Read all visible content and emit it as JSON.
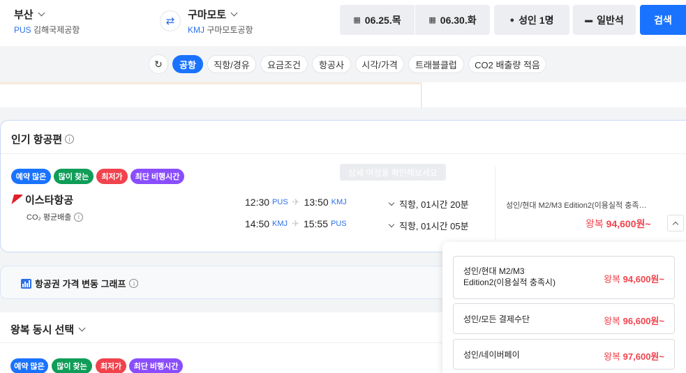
{
  "header": {
    "origin": {
      "city": "부산",
      "code": "PUS",
      "airport": "김해국제공항"
    },
    "destination": {
      "city": "구마모토",
      "code": "KMJ",
      "airport": "구마모토공항"
    },
    "depart_date": "06.25.목",
    "return_date": "06.30.화",
    "passengers": "성인 1명",
    "cabin": "일반석",
    "search": "검색"
  },
  "filters": [
    "공항",
    "직항/경유",
    "요금조건",
    "항공사",
    "시각/가격",
    "트래블클럽",
    "CO2 배출량 적음"
  ],
  "popular": {
    "title": "인기 항공편",
    "badges": [
      "예약 많은",
      "많이 찾는",
      "최저가",
      "최단 비행시간"
    ],
    "tooltip": "상세 여정을 확인해보세요",
    "airline": "이스타항공",
    "co2": "CO₂ 평균배출",
    "legs": [
      {
        "dep_time": "12:30",
        "dep_code": "PUS",
        "arr_time": "13:50",
        "arr_code": "KMJ",
        "type": "직항, 01시간 20분"
      },
      {
        "dep_time": "14:50",
        "dep_code": "KMJ",
        "arr_time": "15:55",
        "arr_code": "PUS",
        "type": "직항, 01시간 05분"
      }
    ],
    "fare_label": "성인/현대 M2/M3 Edition2(이용실적 충족…",
    "fare_prefix": "왕복",
    "fare_price": "94,600원~"
  },
  "graph": {
    "title": "항공권 가격 변동 그래프"
  },
  "roundtrip": {
    "title": "왕복 동시 선택",
    "badges": [
      "예약 많은",
      "많이 찾는",
      "최저가",
      "최단 비행시간"
    ]
  },
  "fare_options": [
    {
      "label_line1": "성인/현대 M2/M3",
      "label_line2": "Edition2(이용실적 충족시)",
      "prefix": "왕복",
      "price": "94,600원~"
    },
    {
      "label_line1": "성인/모든 결제수단",
      "label_line2": "",
      "prefix": "왕복",
      "price": "96,600원~"
    },
    {
      "label_line1": "성인/네이버페이",
      "label_line2": "",
      "prefix": "왕복",
      "price": "97,600원~"
    }
  ]
}
